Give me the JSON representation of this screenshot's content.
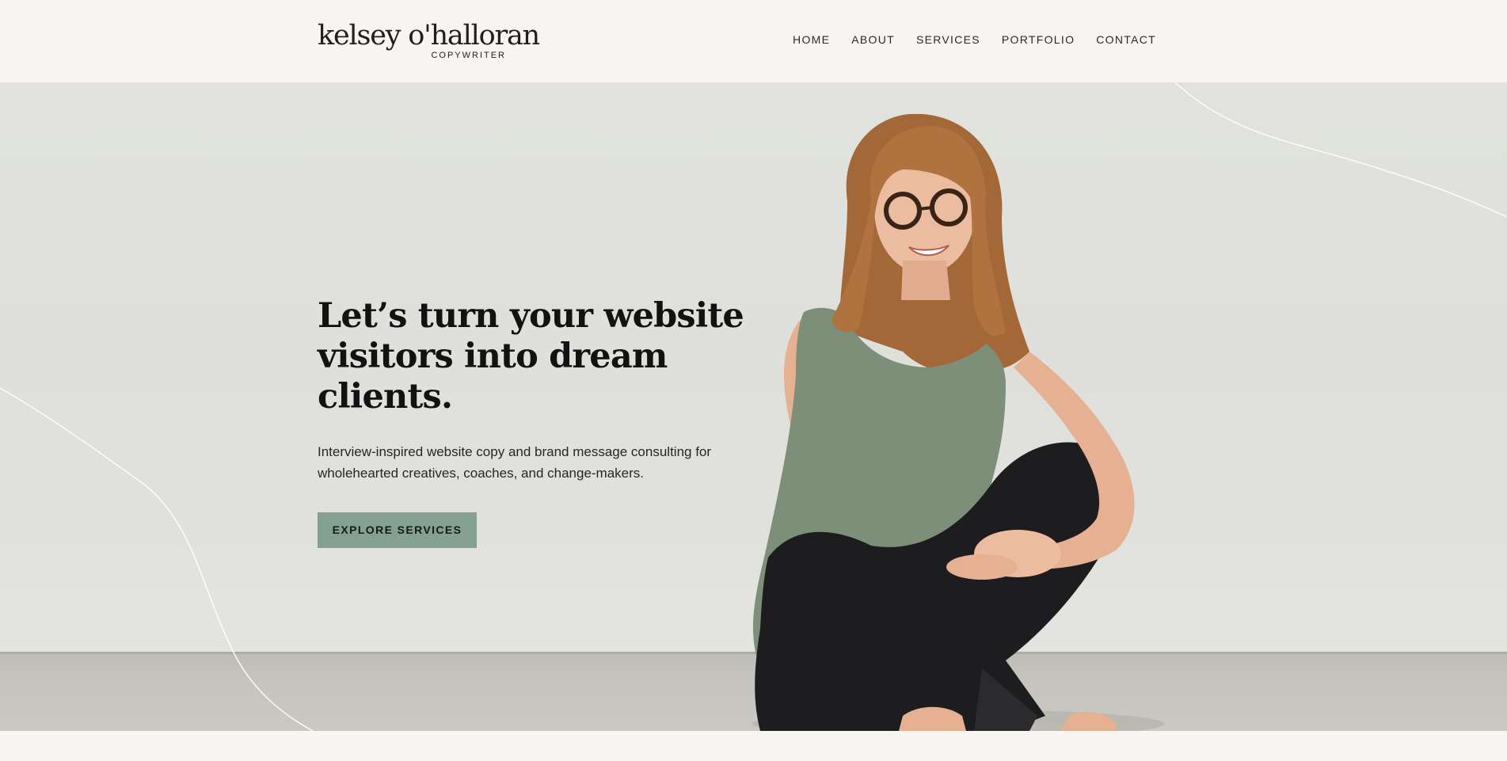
{
  "header": {
    "logo_name": "kelsey o'halloran",
    "logo_sub": "COPYWRITER",
    "nav": [
      "HOME",
      "ABOUT",
      "SERVICES",
      "PORTFOLIO",
      "CONTACT"
    ]
  },
  "hero": {
    "headline": "Let’s turn your website visitors into dream clients.",
    "subtext": "Interview-inspired website copy and brand message consulting for wholehearted creatives, coaches, and change-makers.",
    "cta_label": "EXPLORE SERVICES"
  },
  "colors": {
    "background": "#f7f4f1",
    "hero_wall": "#e0e1dc",
    "floor": "#c5c4bd",
    "cta": "#84a090",
    "shirt": "#7d8f79",
    "jeans": "#1d1d1f",
    "hair": "#a46838"
  },
  "icons": {
    "decor": "curved-line-decoration",
    "photo": "woman-sitting-photo"
  }
}
